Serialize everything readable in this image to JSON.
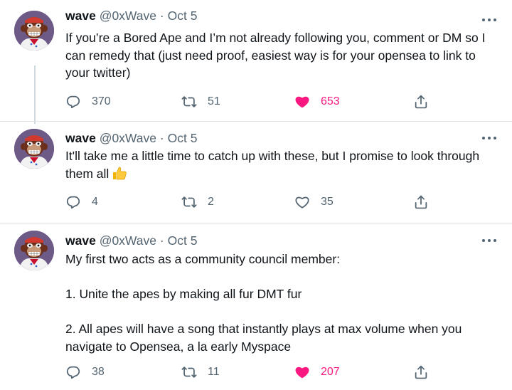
{
  "tweets": [
    {
      "name": "wave",
      "handle": "@0xWave",
      "separator": "·",
      "date": "Oct 5",
      "text": "If you’re a Bored Ape and I’m not already following you, comment or DM so I can remedy that (just need proof, easiest way is for your opensea to link to your twitter)",
      "replies": "370",
      "retweets": "51",
      "likes": "653",
      "liked": true
    },
    {
      "name": "wave",
      "handle": "@0xWave",
      "separator": "·",
      "date": "Oct 5",
      "text": "It'll take me a little time to catch up with these, but I promise to look through them all",
      "emoji": "thumbs-up",
      "replies": "4",
      "retweets": "2",
      "likes": "35",
      "liked": false
    },
    {
      "name": "wave",
      "handle": "@0xWave",
      "separator": "·",
      "date": "Oct 5",
      "text": "My first two acts as a community council member:\n\n1. Unite the apes by making all fur DMT fur\n\n2. All apes will have a song that instantly plays at max volume when you navigate to Opensea, a la early Myspace",
      "replies": "38",
      "retweets": "11",
      "likes": "207",
      "liked": true
    }
  ],
  "icons": {
    "reply": "reply-icon",
    "retweet": "retweet-icon",
    "like": "heart-icon",
    "share": "share-icon",
    "more": "more-icon"
  },
  "colors": {
    "text": "#0f1419",
    "secondary": "#536471",
    "like": "#f91880",
    "divider": "#dfe3e8",
    "thread_line": "#cfd9de",
    "avatar_bg": "#6e5a87"
  }
}
